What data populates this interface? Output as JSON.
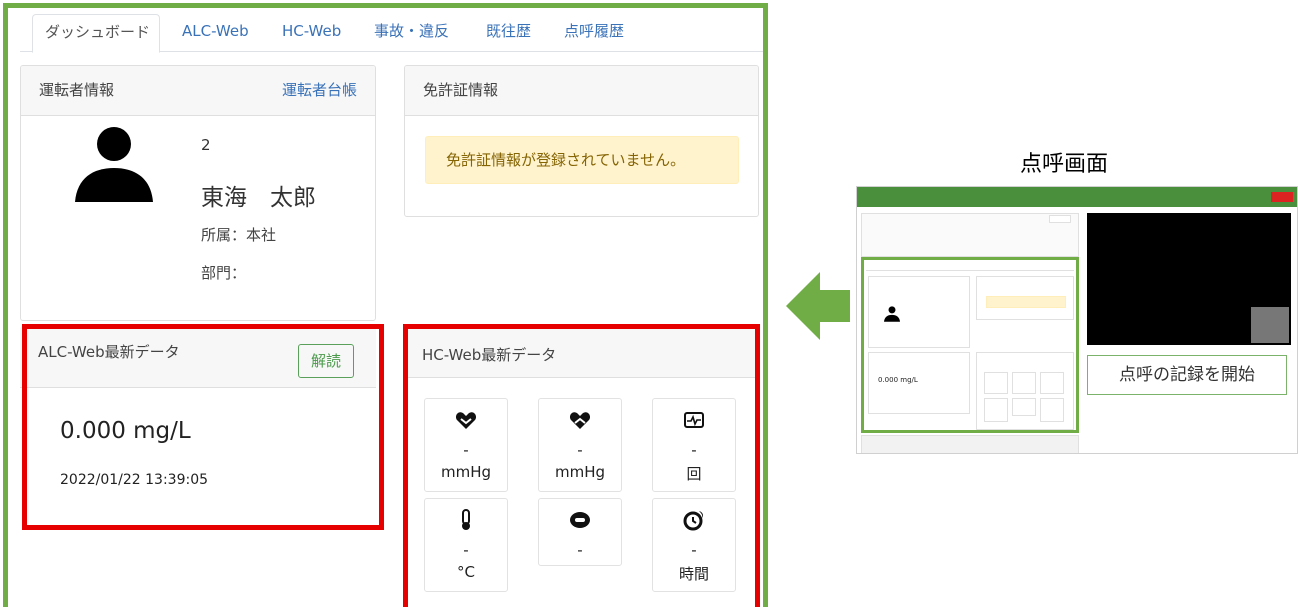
{
  "tabs": [
    "ダッシュボード",
    "ALC-Web",
    "HC-Web",
    "事故・違反",
    "既往歴",
    "点呼履歴"
  ],
  "driver_card": {
    "title": "運転者情報",
    "link": "運転者台帳",
    "id": "2",
    "name": "東海　太郎",
    "affiliation": "所属：本社",
    "department": "部門："
  },
  "license_card": {
    "title": "免許証情報",
    "alert": "免許証情報が登録されていません。"
  },
  "alc_card": {
    "title": "ALC-Web最新データ",
    "button": "解読",
    "value": "0.000 mg/L",
    "timestamp": "2022/01/22 13:39:05"
  },
  "hc_card": {
    "title": "HC-Web最新データ",
    "tiles": [
      {
        "icon": "heart-down-icon",
        "value": "-",
        "unit": "mmHg"
      },
      {
        "icon": "heart-up-icon",
        "value": "-",
        "unit": "mmHg"
      },
      {
        "icon": "pulse-monitor-icon",
        "value": "-",
        "unit": "回"
      },
      {
        "icon": "thermometer-icon",
        "value": "-",
        "unit": "°C"
      },
      {
        "icon": "band-icon",
        "value": "-",
        "unit": ""
      },
      {
        "icon": "sleep-clock-icon",
        "value": "-",
        "unit": "時間"
      }
    ]
  },
  "side": {
    "title": "点呼画面",
    "start_button": "点呼の記録を開始"
  },
  "colors": {
    "green": "#70ad47",
    "red": "#e60000",
    "link": "#3a72b8"
  }
}
